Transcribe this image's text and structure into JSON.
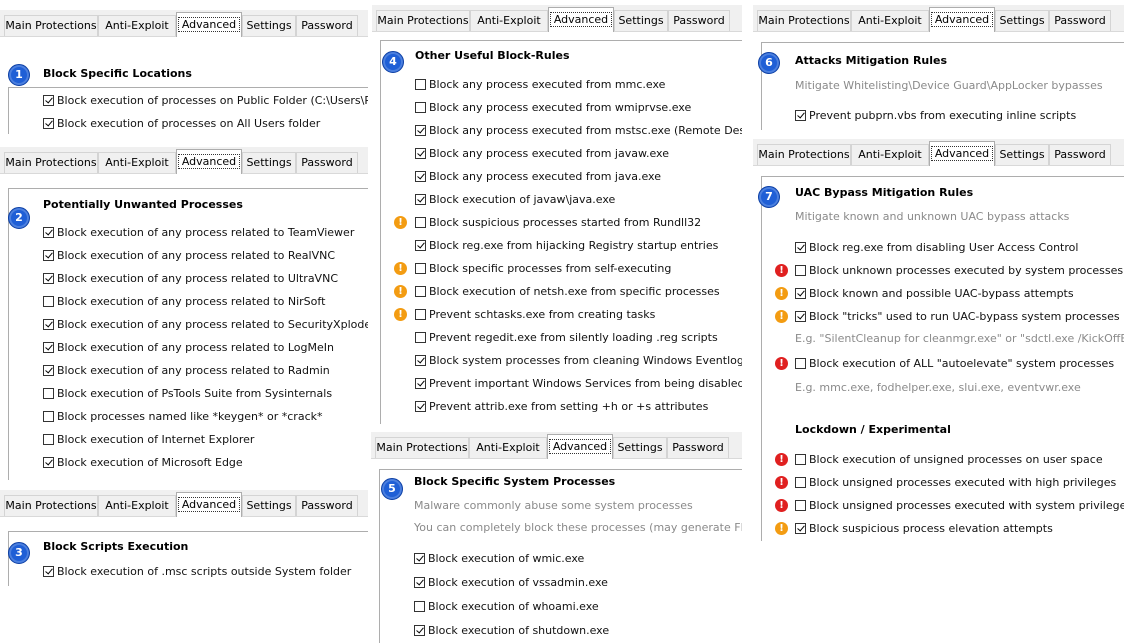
{
  "tabs": [
    "Main Protections",
    "Anti-Exploit",
    "Advanced",
    "Settings",
    "Password"
  ],
  "colors": {
    "badge": "#1f5fd6",
    "warn_orange": "#f39c12",
    "warn_red": "#e02020"
  },
  "icons": {
    "badge": "numbered-circle-icon",
    "warning": "exclamation-icon"
  },
  "panel1": {
    "number": "1",
    "title": "Block Specific Locations",
    "items": [
      {
        "label": "Block execution of processes on Public Folder (C:\\Users\\Public)",
        "checked": true
      },
      {
        "label": "Block execution of processes on All Users folder",
        "checked": true
      }
    ]
  },
  "panel2": {
    "number": "2",
    "title": "Potentially Unwanted Processes",
    "items": [
      {
        "label": "Block execution of any process related to TeamViewer",
        "checked": true
      },
      {
        "label": "Block execution of any process related to RealVNC",
        "checked": true
      },
      {
        "label": "Block execution of any process related to UltraVNC",
        "checked": true
      },
      {
        "label": "Block execution of any process related to NirSoft",
        "checked": false
      },
      {
        "label": "Block execution of any process related to SecurityXploded",
        "checked": true
      },
      {
        "label": "Block execution of any process related to LogMeIn",
        "checked": true
      },
      {
        "label": "Block execution of any process related to Radmin",
        "checked": true
      },
      {
        "label": "Block execution of PsTools Suite from Sysinternals",
        "checked": false
      },
      {
        "label": "Block processes named like *keygen* or *crack*",
        "checked": false
      },
      {
        "label": "Block execution of Internet Explorer",
        "checked": false
      },
      {
        "label": "Block execution of Microsoft Edge",
        "checked": true
      }
    ]
  },
  "panel3": {
    "number": "3",
    "title": "Block Scripts Execution",
    "items": [
      {
        "label": "Block execution of .msc scripts outside System folder",
        "checked": true
      }
    ]
  },
  "panel4": {
    "number": "4",
    "title": "Other Useful Block-Rules",
    "items": [
      {
        "label": "Block any process executed from mmc.exe",
        "checked": false,
        "warn": ""
      },
      {
        "label": "Block any process executed from wmiprvse.exe",
        "checked": false,
        "warn": ""
      },
      {
        "label": "Block any process executed from mstsc.exe (Remote Desktop)",
        "checked": true,
        "warn": ""
      },
      {
        "label": "Block any process executed from javaw.exe",
        "checked": true,
        "warn": ""
      },
      {
        "label": "Block any process executed from java.exe",
        "checked": true,
        "warn": ""
      },
      {
        "label": "Block execution of javaw\\java.exe",
        "checked": true,
        "warn": ""
      },
      {
        "label": "Block suspicious processes started from Rundll32",
        "checked": false,
        "warn": "orange"
      },
      {
        "label": "Block reg.exe from hijacking Registry startup entries",
        "checked": true,
        "warn": ""
      },
      {
        "label": "Block specific processes from self-executing",
        "checked": false,
        "warn": "orange"
      },
      {
        "label": "Block execution of netsh.exe from specific processes",
        "checked": false,
        "warn": "orange"
      },
      {
        "label": "Prevent schtasks.exe from creating tasks",
        "checked": false,
        "warn": "orange"
      },
      {
        "label": "Prevent regedit.exe from silently loading .reg scripts",
        "checked": false,
        "warn": ""
      },
      {
        "label": "Block system processes from cleaning Windows Eventlog",
        "checked": true,
        "warn": ""
      },
      {
        "label": "Prevent important Windows Services from being disabled",
        "checked": true,
        "warn": ""
      },
      {
        "label": "Prevent attrib.exe from setting +h or +s attributes",
        "checked": true,
        "warn": ""
      }
    ]
  },
  "panel5": {
    "number": "5",
    "title": "Block Specific System Processes",
    "subs": [
      "Malware commonly abuse some system processes",
      "You can completely block these processes (may generate FPs)"
    ],
    "items": [
      {
        "label": "Block execution of wmic.exe",
        "checked": true
      },
      {
        "label": "Block execution of vssadmin.exe",
        "checked": true
      },
      {
        "label": "Block execution of whoami.exe",
        "checked": false
      },
      {
        "label": "Block execution of shutdown.exe",
        "checked": true
      }
    ]
  },
  "panel6": {
    "number": "6",
    "title": "Attacks Mitigation Rules",
    "sub": "Mitigate Whitelisting\\Device Guard\\AppLocker bypasses",
    "items": [
      {
        "label": "Prevent pubprn.vbs from executing inline scripts",
        "checked": true
      }
    ]
  },
  "panel7": {
    "number": "7",
    "title": "UAC Bypass Mitigation Rules",
    "sub": "Mitigate known and unknown UAC bypass attacks",
    "items": [
      {
        "label": "Block reg.exe from disabling User Access Control",
        "checked": true,
        "warn": ""
      },
      {
        "label": "Block unknown processes executed by system processes",
        "checked": false,
        "warn": "red"
      },
      {
        "label": "Block known and possible UAC-bypass attempts",
        "checked": true,
        "warn": "orange"
      },
      {
        "label": "Block \"tricks\" used to run UAC-bypass system processes",
        "checked": true,
        "warn": "orange"
      }
    ],
    "example1": "E.g. \"SilentCleanup for cleanmgr.exe\" or \"sdctl.exe /KickOffElev\"",
    "item_autoelevate": {
      "label": "Block execution of ALL \"autoelevate\" system processes",
      "checked": false,
      "warn": "red"
    },
    "example2": "E.g. mmc.exe, fodhelper.exe, slui.exe, eventvwr.exe",
    "lockdown_title": "Lockdown / Experimental",
    "lockdown_items": [
      {
        "label": "Block execution of unsigned processes on user space",
        "checked": false,
        "warn": "red"
      },
      {
        "label": "Block unsigned processes executed with high privileges",
        "checked": false,
        "warn": "red"
      },
      {
        "label": "Block unsigned processes executed with system privileges",
        "checked": false,
        "warn": "red"
      },
      {
        "label": "Block suspicious process elevation attempts",
        "checked": true,
        "warn": "orange"
      }
    ]
  }
}
